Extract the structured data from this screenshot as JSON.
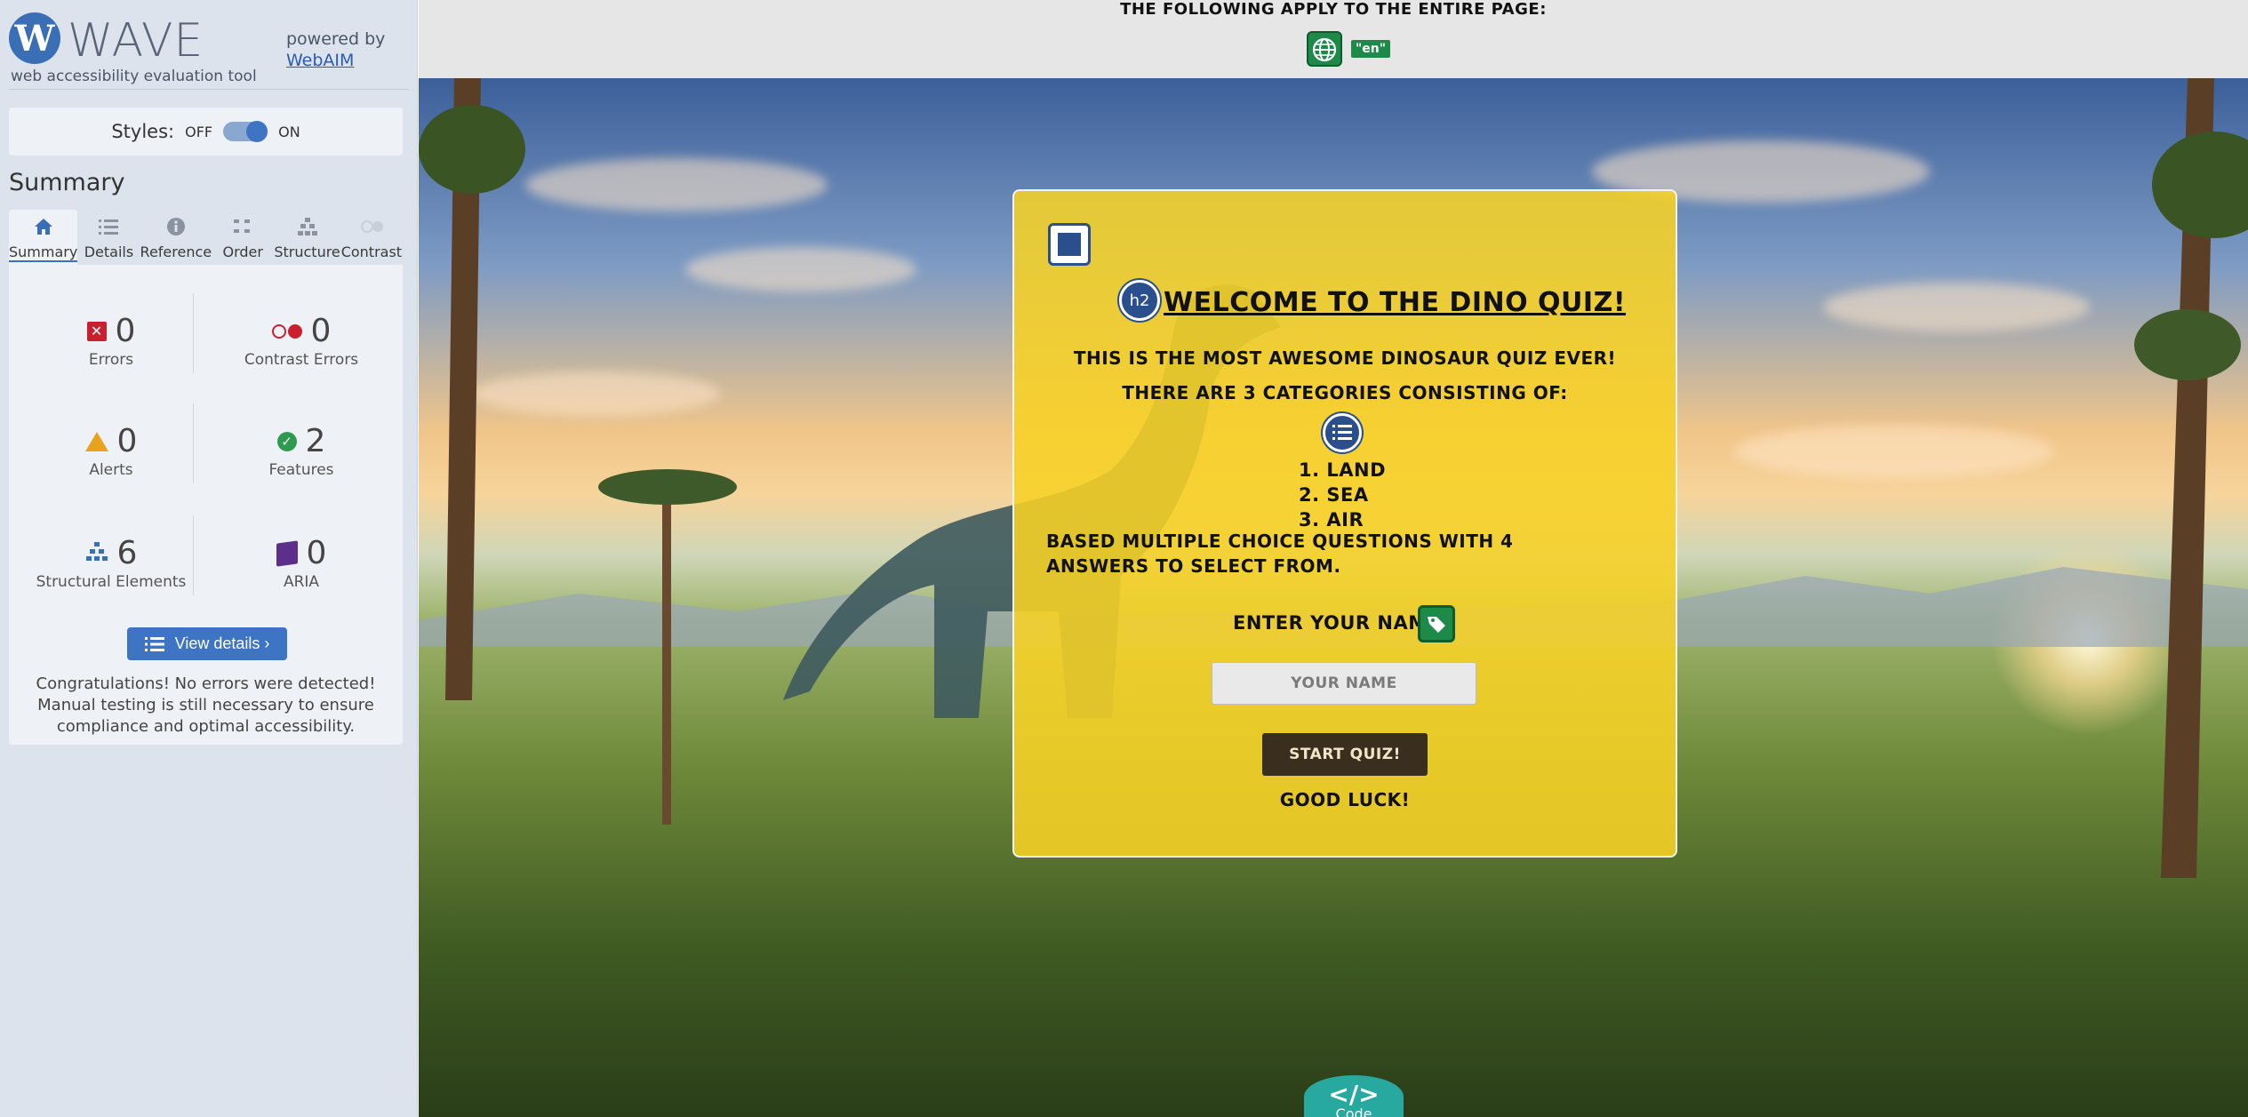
{
  "wave": {
    "logo_letter": "W",
    "logo_text": "WAVE",
    "tagline": "web accessibility evaluation tool",
    "powered_by": "powered by",
    "webaim_link": "WebAIM",
    "styles_label": "Styles:",
    "toggle_off": "OFF",
    "toggle_on": "ON",
    "summary_title": "Summary",
    "tabs": [
      {
        "label": "Summary",
        "icon": "home-icon"
      },
      {
        "label": "Details",
        "icon": "list-icon"
      },
      {
        "label": "Reference",
        "icon": "info-icon"
      },
      {
        "label": "Order",
        "icon": "order-icon"
      },
      {
        "label": "Structure",
        "icon": "structure-icon"
      },
      {
        "label": "Contrast",
        "icon": "contrast-icon"
      }
    ],
    "stats": {
      "errors": {
        "count": "0",
        "label": "Errors"
      },
      "contrast_errors": {
        "count": "0",
        "label": "Contrast Errors"
      },
      "alerts": {
        "count": "0",
        "label": "Alerts"
      },
      "features": {
        "count": "2",
        "label": "Features"
      },
      "structural": {
        "count": "6",
        "label": "Structural Elements"
      },
      "aria": {
        "count": "0",
        "label": "ARIA"
      }
    },
    "view_details": "View details ›",
    "congrats": "Congratulations! No errors were detected! Manual testing is still necessary to ensure compliance and optimal accessibility."
  },
  "pagebar": {
    "text": "THE FOLLOWING APPLY TO THE ENTIRE PAGE:",
    "lang": "\"en\""
  },
  "quiz": {
    "h2_badge": "h2",
    "title": "WELCOME TO THE DINO QUIZ!",
    "line1": "THIS IS THE MOST AWESOME DINOSAUR QUIZ EVER!",
    "line2": "THERE ARE 3 CATEGORIES CONSISTING OF:",
    "categories": [
      "1. LAND",
      "2. SEA",
      "3. AIR"
    ],
    "description": "BASED MULTIPLE CHOICE QUESTIONS WITH 4 ANSWERS TO SELECT FROM.",
    "name_label": "ENTER YOUR NAME:",
    "name_placeholder": "YOUR NAME",
    "start_button": "START QUIZ!",
    "good_luck": "GOOD LUCK!"
  },
  "code_tab": {
    "glyph": "</>",
    "label": "Code"
  },
  "colors": {
    "wave_blue": "#3d74c4",
    "error_red": "#c8202f",
    "feature_green": "#2e9a4f",
    "alert_orange": "#e9a21b",
    "aria_purple": "#5b2f8a",
    "quiz_yellow": "#f7d226",
    "code_teal": "#27a9a0"
  }
}
